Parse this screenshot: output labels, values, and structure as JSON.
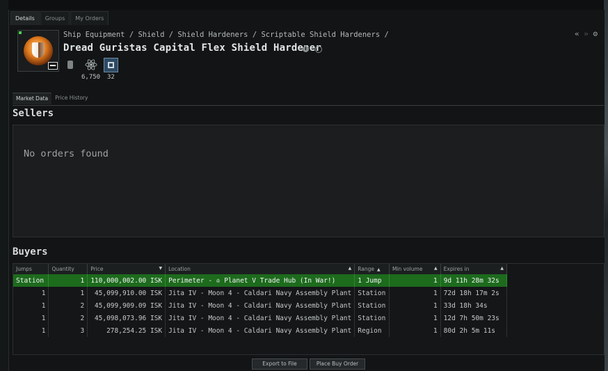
{
  "tabs": [
    "Details",
    "Groups",
    "My Orders"
  ],
  "breadcrumb": "Ship Equipment / Shield / Shield Hardeners / Scriptable Shield Hardeners /",
  "item_title": "Dread Guristas Capital Flex Shield Hardener",
  "meta_badge": "▬▬",
  "attributes": {
    "a1": "6,750",
    "a2": "32"
  },
  "subtabs": [
    "Market Data",
    "Price History"
  ],
  "sellers": {
    "heading": "Sellers",
    "empty_text": "No orders found"
  },
  "buyers": {
    "heading": "Buyers",
    "columns": [
      "Jumps",
      "Quantity",
      "Price",
      "Location",
      "Range",
      "Min volume",
      "Expires in"
    ],
    "rows": [
      {
        "jumps": "Station",
        "quantity": "1",
        "price": "110,000,002.00 ISK",
        "location": "Perimeter - ♔ Planet V Trade Hub (In War!)",
        "range": "1 Jump",
        "min_volume": "1",
        "expires": "9d 11h 28m 32s"
      },
      {
        "jumps": "1",
        "quantity": "1",
        "price": "45,099,910.00 ISK",
        "location": "Jita IV - Moon 4 - Caldari Navy Assembly Plant",
        "range": "Station",
        "min_volume": "1",
        "expires": "72d 18h 17m 2s"
      },
      {
        "jumps": "1",
        "quantity": "2",
        "price": "45,099,909.09 ISK",
        "location": "Jita IV - Moon 4 - Caldari Navy Assembly Plant",
        "range": "Station",
        "min_volume": "1",
        "expires": "33d 18h 34s"
      },
      {
        "jumps": "1",
        "quantity": "2",
        "price": "45,098,073.96 ISK",
        "location": "Jita IV - Moon 4 - Caldari Navy Assembly Plant",
        "range": "Station",
        "min_volume": "1",
        "expires": "12d 7h 50m 23s"
      },
      {
        "jumps": "1",
        "quantity": "3",
        "price": "278,254.25 ISK",
        "location": "Jita IV - Moon 4 - Caldari Navy Assembly Plant",
        "range": "Region",
        "min_volume": "1",
        "expires": "80d 2h 5m 11s"
      }
    ]
  },
  "buttons": {
    "export": "Export to File",
    "place_buy": "Place Buy Order"
  },
  "colors": {
    "selected_row": "#1d6b1d",
    "background": "#121415"
  }
}
